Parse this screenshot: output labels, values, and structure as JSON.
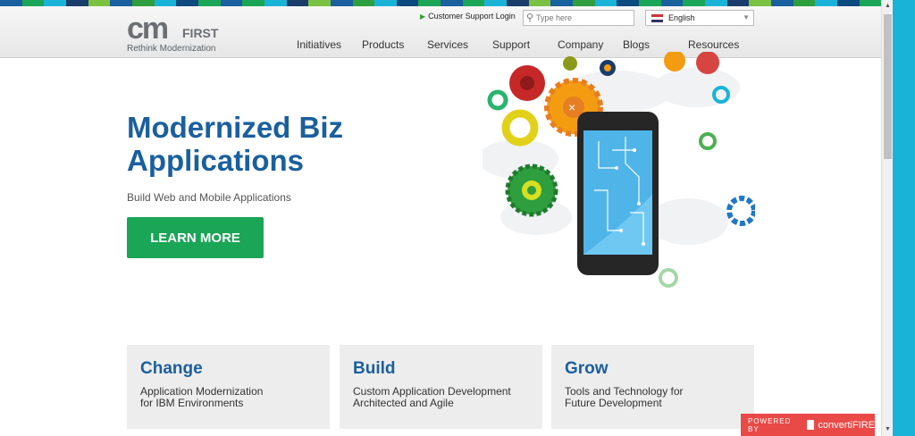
{
  "header": {
    "logo": {
      "mark": "cm",
      "first": "FIRST",
      "tagline": "Rethink Modernization"
    },
    "support_link": "Customer Support Login",
    "search": {
      "placeholder": "Type here",
      "value": ""
    },
    "language": {
      "selected": "English"
    },
    "nav": [
      "Initiatives",
      "Products",
      "Services",
      "Support",
      "Company",
      "Blogs",
      "Resources"
    ]
  },
  "hero": {
    "title": "Modernized Biz Applications",
    "subtitle": "Build Web and Mobile Applications",
    "cta": "LEARN MORE"
  },
  "cards": [
    {
      "title": "Change",
      "desc": "Application Modernization\nfor IBM Environments"
    },
    {
      "title": "Build",
      "desc": "Custom Application Development\nArchitected and Agile"
    },
    {
      "title": "Grow",
      "desc": "Tools and Technology for\nFuture Development"
    }
  ],
  "powered": {
    "prefix": "POWERED BY",
    "brand": "convertiFIRE"
  },
  "colors": {
    "brand_blue": "#1a5f9e",
    "cta_green": "#1aa557",
    "accent_cyan": "#1ab3d8",
    "powered_red": "#e94a47"
  }
}
